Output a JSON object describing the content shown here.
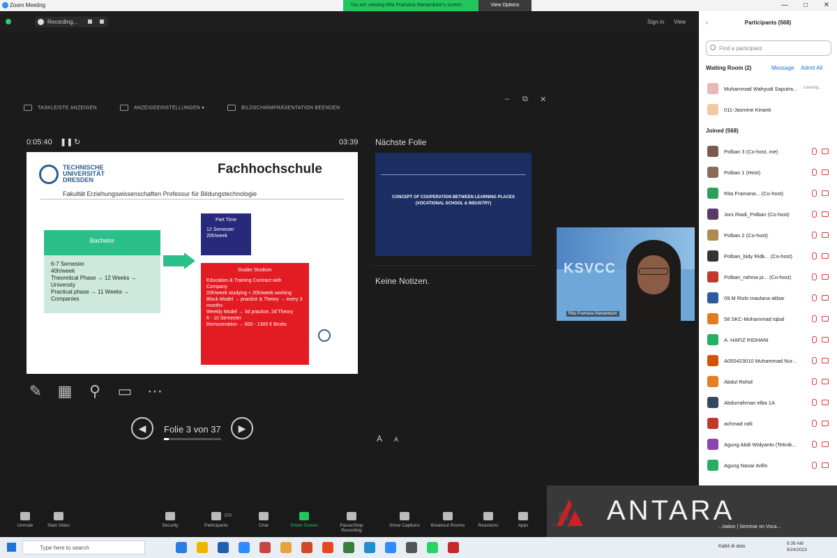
{
  "window": {
    "title": "Zoom Meeting"
  },
  "share_bar": {
    "text": "You are viewing Rita Framana Manambam's screen",
    "view_options": "View Options"
  },
  "top": {
    "recording": "Recording...",
    "sign_in": "Sign in",
    "view": "View"
  },
  "presenter_toolbar": {
    "show_taskbar": "TASKLEISTE ANZEIGEN",
    "display_settings": "ANZEIGEEINSTELLUNGEN ▾",
    "end_slideshow": "BILDSCHIRMPRÄSENTATION BEENDEN"
  },
  "timer": {
    "elapsed": "0:05:40",
    "clock": "03:39"
  },
  "slide": {
    "university": "TECHNISCHE UNIVERSITÄT DRESDEN",
    "heading": "Fachhochschule",
    "faculty": "Fakultät Erziehungswissenschaften Professur für Bildungstechnologie",
    "bachelor_title": "Bachelor",
    "bachelor_items": [
      "6-7 Semester",
      "40h/week",
      "Theoretical Phase → 12 Weeks → University",
      "Practical phase → 11 Weeks → Companies"
    ],
    "parttime_title": "Part Time",
    "parttime_items": [
      "12 Semester",
      "20h/week"
    ],
    "dual_title": "Dualer Studium",
    "dual_items": [
      "Education & Training Contract with Company",
      "20h/week studying + 20h/week working",
      "Block Model → practice & Theory → every 3 months",
      "Weekly Model → 3d practice, 2d Theory",
      "6 - 10 Semester",
      "Remuneration → 600 - 1300 € Brutto"
    ]
  },
  "navigation": {
    "slide_counter": "Folie 3 von 37",
    "progress": 0.081
  },
  "next": {
    "label": "Nächste Folie",
    "slide_title": "CONCEPT OF COOPERATION BETWEEN LEARNING PLACES (VOCATIONAL SCHOOL & INDUSTRY)",
    "notes": "Keine Notizen."
  },
  "video": {
    "name": "Rita Framana Manambam",
    "banner_text": "KSVCC"
  },
  "participants": {
    "title": "Participants (568)",
    "search_placeholder": "Find a participant",
    "waiting_room": "Waiting Room (2)",
    "message": "Message",
    "admit_all": "Admit All",
    "joined": "Joined (568)",
    "waiting": [
      {
        "name": "Muhammad Wahyudi Saputra...",
        "hint": "Leaving...",
        "color": "#e8b7b7"
      },
      {
        "name": "011-Jasmine Kinanti",
        "hint": "",
        "color": "#f1c9a5"
      }
    ],
    "list": [
      {
        "name": "Polban 3 (Co-host, me)",
        "color": "#7a5a4a"
      },
      {
        "name": "Polban 1 (Host)",
        "color": "#8a6a5a"
      },
      {
        "name": "Rita Framana... (Co-host)",
        "color": "#2e9e5b"
      },
      {
        "name": "Joni Riadi_Polban (Co-host)",
        "color": "#5a3a6a"
      },
      {
        "name": "Polban 2 (Co-host)",
        "color": "#b08a50"
      },
      {
        "name": "Polban_bidy Ridk... (Co-host)",
        "color": "#333333"
      },
      {
        "name": "Polban_rahma pi... (Co-host)",
        "color": "#c0392b"
      },
      {
        "name": "09.M Rizki maulana akbar",
        "color": "#2c5c9e"
      },
      {
        "name": "58 SKC-Mohammad Iqbal",
        "color": "#e07b22"
      },
      {
        "name": "A. HAFIZ RIDHANI",
        "color": "#27ae60"
      },
      {
        "name": "A050423010 Muhammad Nur...",
        "color": "#d35400"
      },
      {
        "name": "Abdul Rohid",
        "color": "#e67e22"
      },
      {
        "name": "Abdurrahman elba 1A",
        "color": "#34495e"
      },
      {
        "name": "achmad rafii",
        "color": "#c0392b"
      },
      {
        "name": "Agung Abdi Widyanto (Teknik...",
        "color": "#8e44ad"
      },
      {
        "name": "Agung Nasar Arifin",
        "color": "#27ae60"
      }
    ]
  },
  "toolbar": {
    "items": [
      "Unmute",
      "Start Video",
      "Security",
      "Participants",
      "Chat",
      "Share Screen",
      "Pause/Stop Recording",
      "Show Captions",
      "Breakout Rooms",
      "Reactions",
      "Apps",
      "Whiteboards"
    ],
    "participant_count": "570"
  },
  "watermark": {
    "brand": "ANTARA",
    "caption": "...itation | Seminar on Voca..."
  },
  "taskbar": {
    "search": "Type here to search",
    "tray": "Kabit di atas",
    "time": "9:39 AM",
    "date": "9/24/2023"
  }
}
